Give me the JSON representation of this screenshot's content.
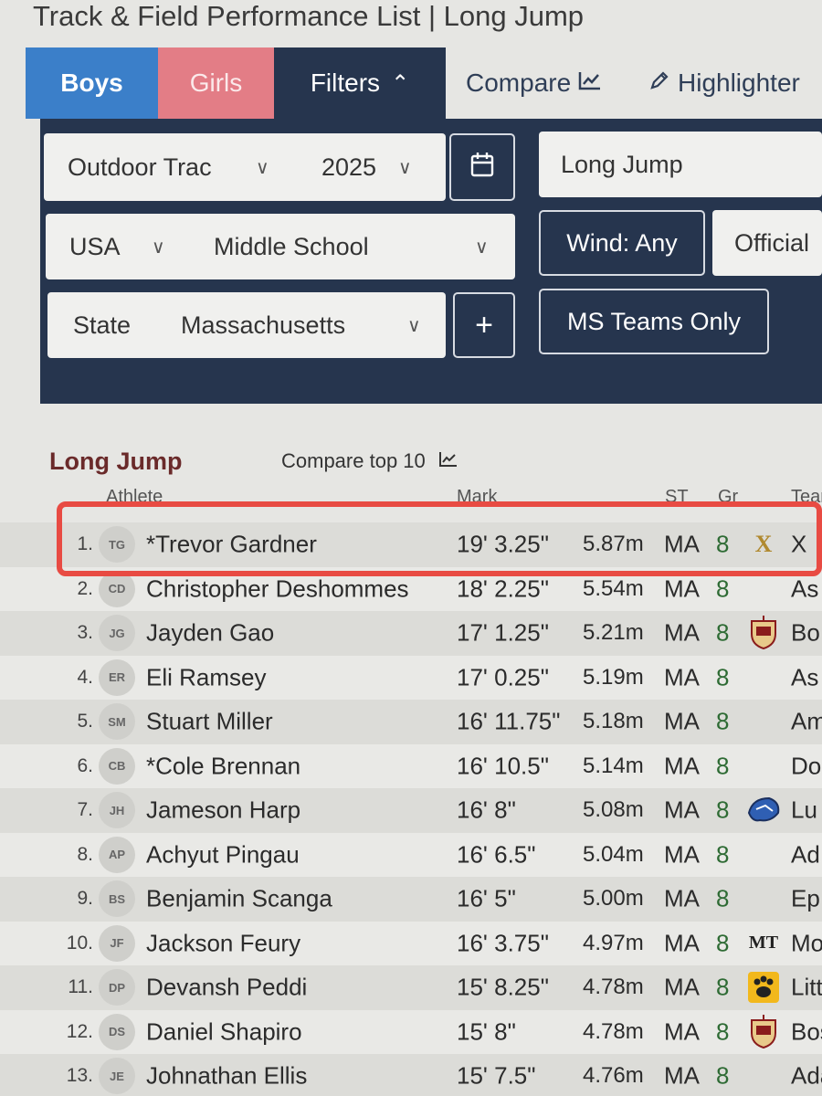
{
  "page": {
    "title": "Track & Field Performance List | Long Jump"
  },
  "tabs": {
    "boys": "Boys",
    "girls": "Girls",
    "filters": "Filters",
    "compare": "Compare",
    "highlighter": "Highlighter"
  },
  "filters": {
    "season": "Outdoor Trac",
    "year": "2025",
    "event": "Long Jump",
    "country": "USA",
    "level": "Middle School",
    "wind": "Wind: Any",
    "official": "Official",
    "region_type": "State",
    "region": "Massachusetts",
    "add": "+",
    "ms_teams": "MS Teams Only"
  },
  "list": {
    "title": "Long Jump",
    "compare_top": "Compare top 10",
    "headers": {
      "athlete": "Athlete",
      "mark": "Mark",
      "st": "ST",
      "gr": "Gr",
      "team": "Team"
    },
    "rows": [
      {
        "rank": "1.",
        "initials": "TG",
        "name": "*Trevor Gardner",
        "mark": "19' 3.25\"",
        "metric": "5.87m",
        "st": "MA",
        "gr": "8",
        "logo": "X",
        "team": "X"
      },
      {
        "rank": "2.",
        "initials": "CD",
        "name": "Christopher Deshommes",
        "mark": "18' 2.25\"",
        "metric": "5.54m",
        "st": "MA",
        "gr": "8",
        "logo": "",
        "team": "As"
      },
      {
        "rank": "3.",
        "initials": "JG",
        "name": "Jayden Gao",
        "mark": "17' 1.25\"",
        "metric": "5.21m",
        "st": "MA",
        "gr": "8",
        "logo": "crest",
        "team": "Bo"
      },
      {
        "rank": "4.",
        "initials": "ER",
        "name": "Eli Ramsey",
        "mark": "17' 0.25\"",
        "metric": "5.19m",
        "st": "MA",
        "gr": "8",
        "logo": "",
        "team": "As"
      },
      {
        "rank": "5.",
        "initials": "SM",
        "name": "Stuart Miller",
        "mark": "16' 11.75\"",
        "metric": "5.18m",
        "st": "MA",
        "gr": "8",
        "logo": "",
        "team": "Am"
      },
      {
        "rank": "6.",
        "initials": "CB",
        "name": "*Cole Brennan",
        "mark": "16' 10.5\"",
        "metric": "5.14m",
        "st": "MA",
        "gr": "8",
        "logo": "",
        "team": "Do"
      },
      {
        "rank": "7.",
        "initials": "JH",
        "name": "Jameson Harp",
        "mark": "16' 8\"",
        "metric": "5.08m",
        "st": "MA",
        "gr": "8",
        "logo": "mascot",
        "team": "Lu"
      },
      {
        "rank": "8.",
        "initials": "AP",
        "name": "Achyut Pingau",
        "mark": "16' 6.5\"",
        "metric": "5.04m",
        "st": "MA",
        "gr": "8",
        "logo": "",
        "team": "Ad"
      },
      {
        "rank": "9.",
        "initials": "BS",
        "name": "Benjamin Scanga",
        "mark": "16' 5\"",
        "metric": "5.00m",
        "st": "MA",
        "gr": "8",
        "logo": "",
        "team": "Ep"
      },
      {
        "rank": "10.",
        "initials": "JF",
        "name": "Jackson Feury",
        "mark": "16' 3.75\"",
        "metric": "4.97m",
        "st": "MA",
        "gr": "8",
        "logo": "MT",
        "team": "Mo"
      },
      {
        "rank": "11.",
        "initials": "DP",
        "name": "Devansh Peddi",
        "mark": "15' 8.25\"",
        "metric": "4.78m",
        "st": "MA",
        "gr": "8",
        "logo": "paw",
        "team": "Litt"
      },
      {
        "rank": "12.",
        "initials": "DS",
        "name": "Daniel Shapiro",
        "mark": "15' 8\"",
        "metric": "4.78m",
        "st": "MA",
        "gr": "8",
        "logo": "crest",
        "team": "Bos"
      },
      {
        "rank": "13.",
        "initials": "JE",
        "name": "Johnathan Ellis",
        "mark": "15' 7.5\"",
        "metric": "4.76m",
        "st": "MA",
        "gr": "8",
        "logo": "",
        "team": "Ada"
      }
    ]
  },
  "colors": {
    "boys_tab": "#3b7fc9",
    "girls_tab": "#e37d86",
    "filter_panel": "#26354e",
    "highlight": "#e84b43",
    "grade": "#2e6b34"
  }
}
